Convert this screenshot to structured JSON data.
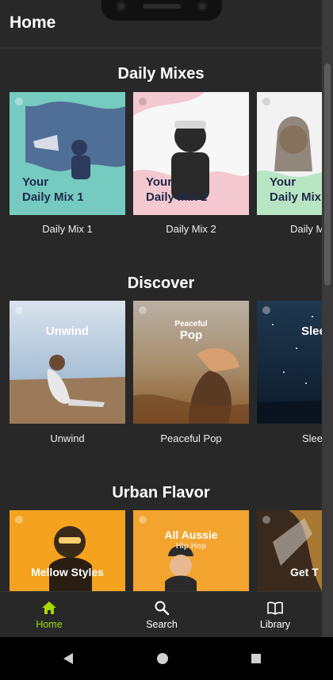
{
  "header": {
    "title": "Home"
  },
  "sections": [
    {
      "title": "Daily Mixes",
      "cards": [
        {
          "label": "Daily Mix 1",
          "art_line1": "Your",
          "art_line2": "Daily Mix 1"
        },
        {
          "label": "Daily Mix 2",
          "art_line1": "Your",
          "art_line2": "Daily Mix 2"
        },
        {
          "label": "Daily M",
          "art_line1": "Your",
          "art_line2": "Daily Mix"
        }
      ]
    },
    {
      "title": "Discover",
      "cards": [
        {
          "label": "Unwind",
          "art_text": "Unwind"
        },
        {
          "label": "Peaceful Pop",
          "art_small": "Peaceful",
          "art_text": "Pop"
        },
        {
          "label": "Slee",
          "art_text": "Slee"
        }
      ]
    },
    {
      "title": "Urban Flavor",
      "cards": [
        {
          "art_text": "Mellow Styles"
        },
        {
          "art_text": "All Aussie",
          "art_sub": "Hip Hop"
        },
        {
          "art_text": "Get T"
        }
      ]
    }
  ],
  "nav": [
    {
      "label": "Home",
      "icon": "home-icon",
      "active": true
    },
    {
      "label": "Search",
      "icon": "search-icon"
    },
    {
      "label": "Library",
      "icon": "book-icon"
    }
  ],
  "colors": {
    "accent": "#a4d800",
    "background": "#282828"
  }
}
